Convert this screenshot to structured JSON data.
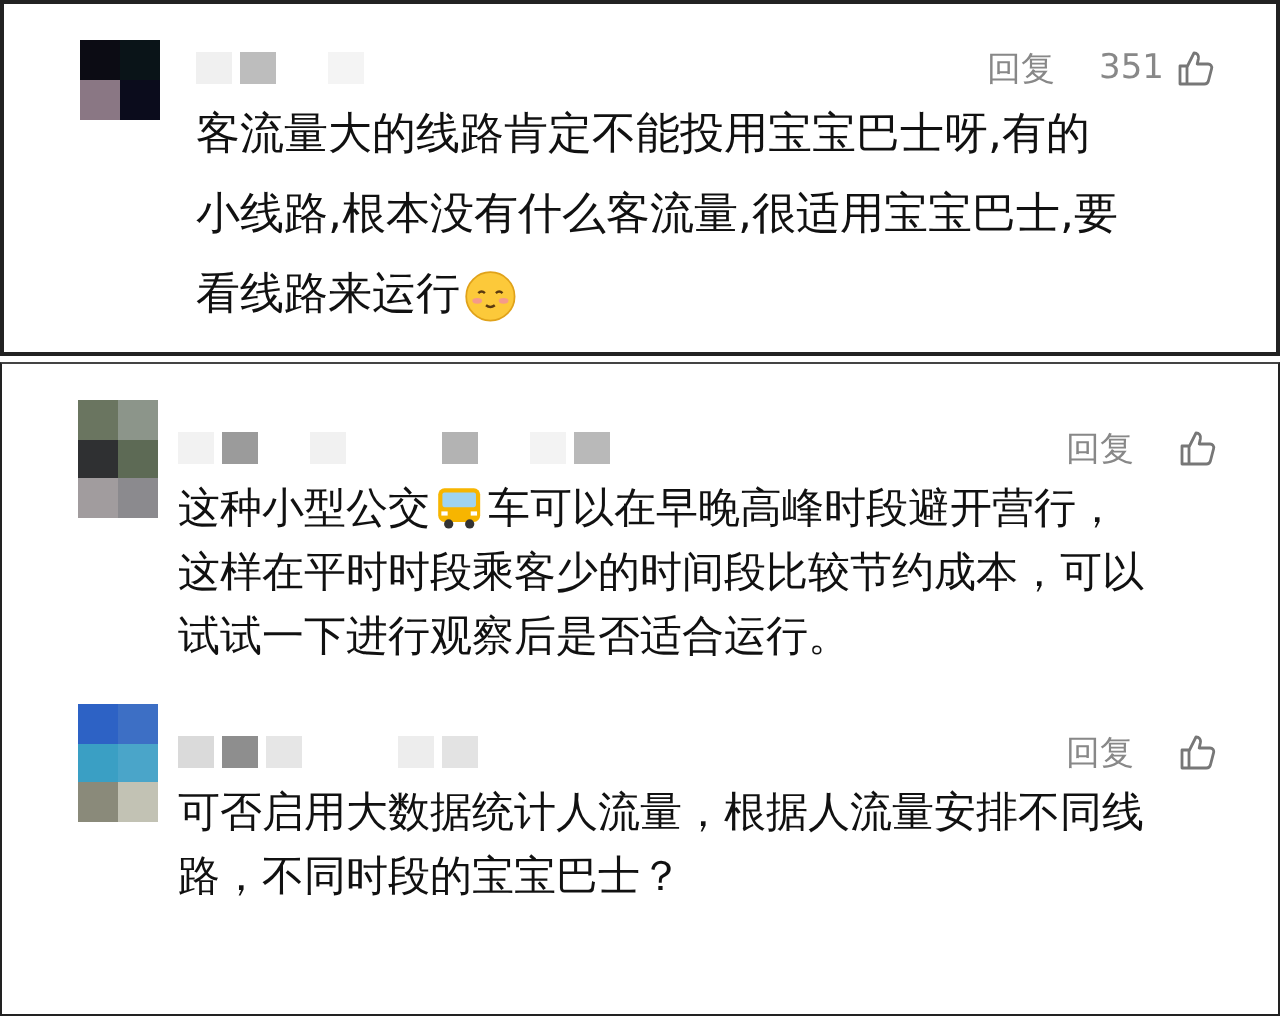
{
  "panels": [
    {
      "comments": [
        {
          "reply": "回复",
          "likes": "351",
          "lines": [
            [
              {
                "kind": "text",
                "text": "客流量大的线路肯定不能投用宝宝巴士呀,有的"
              }
            ],
            [
              {
                "kind": "text",
                "text": "小线路,根本没有什么客流量,很适用宝宝巴士,要"
              }
            ],
            [
              {
                "kind": "text",
                "text": "看线路来运行"
              },
              {
                "kind": "smiley"
              }
            ]
          ]
        }
      ]
    },
    {
      "comments": [
        {
          "reply": "回复",
          "lines": [
            [
              {
                "kind": "text",
                "text": "这种小型公交"
              },
              {
                "kind": "bus"
              },
              {
                "kind": "text",
                "text": "车可以在早晚高峰时段避开营行，"
              }
            ],
            [
              {
                "kind": "text",
                "text": "这样在平时时段乘客少的时间段比较节约成本，可以"
              }
            ],
            [
              {
                "kind": "text",
                "text": "试试一下进行观察后是否适合运行。"
              }
            ]
          ]
        },
        {
          "reply": "回复",
          "lines": [
            [
              {
                "kind": "text",
                "text": "可否启用大数据统计人流量，根据人流量安排不同线"
              }
            ],
            [
              {
                "kind": "text",
                "text": "路，不同时段的宝宝巴士？"
              }
            ]
          ]
        }
      ]
    }
  ]
}
